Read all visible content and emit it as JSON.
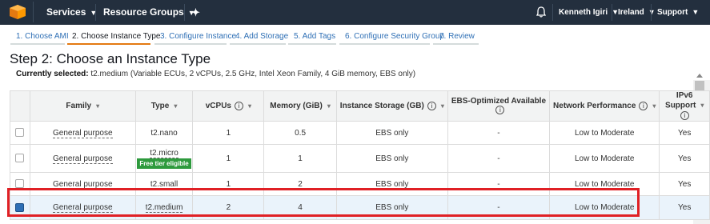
{
  "topbar": {
    "services": "Services",
    "resource_groups": "Resource Groups",
    "user": "Kenneth Igiri",
    "region": "Ireland",
    "support": "Support"
  },
  "steps": [
    {
      "label": "1. Choose AMI"
    },
    {
      "label": "2. Choose Instance Type"
    },
    {
      "label": "3. Configure Instance"
    },
    {
      "label": "4. Add Storage"
    },
    {
      "label": "5. Add Tags"
    },
    {
      "label": "6. Configure Security Group"
    },
    {
      "label": "7. Review"
    }
  ],
  "page": {
    "title": "Step 2: Choose an Instance Type",
    "currently_selected_label": "Currently selected:",
    "currently_selected_value": "t2.medium (Variable ECUs, 2 vCPUs, 2.5 GHz, Intel Xeon Family, 4 GiB memory, EBS only)"
  },
  "table": {
    "headers": {
      "family": "Family",
      "type": "Type",
      "vcpus": "vCPUs",
      "memory": "Memory (GiB)",
      "storage": "Instance Storage (GB)",
      "ebs_opt": "EBS-Optimized Available",
      "network": "Network Performance",
      "ipv6_line1": "IPv6",
      "ipv6_line2": "Support"
    },
    "rows": [
      {
        "family": "General purpose",
        "type": "t2.nano",
        "badge": "",
        "vcpus": "1",
        "memory": "0.5",
        "storage": "EBS only",
        "ebs": "-",
        "network": "Low to Moderate",
        "ipv6": "Yes"
      },
      {
        "family": "General purpose",
        "type": "t2.micro",
        "badge": "Free tier eligible",
        "vcpus": "1",
        "memory": "1",
        "storage": "EBS only",
        "ebs": "-",
        "network": "Low to Moderate",
        "ipv6": "Yes"
      },
      {
        "family": "General purpose",
        "type": "t2.small",
        "badge": "",
        "vcpus": "1",
        "memory": "2",
        "storage": "EBS only",
        "ebs": "-",
        "network": "Low to Moderate",
        "ipv6": "Yes"
      },
      {
        "family": "General purpose",
        "type": "t2.medium",
        "badge": "",
        "vcpus": "2",
        "memory": "4",
        "storage": "EBS only",
        "ebs": "-",
        "network": "Low to Moderate",
        "ipv6": "Yes"
      }
    ]
  },
  "colors": {
    "topbar_bg": "#232f3e",
    "active_tab": "#e47911",
    "link": "#2e6fb5",
    "highlight_border": "#e02025",
    "free_tier_badge": "#2e9a3d"
  }
}
